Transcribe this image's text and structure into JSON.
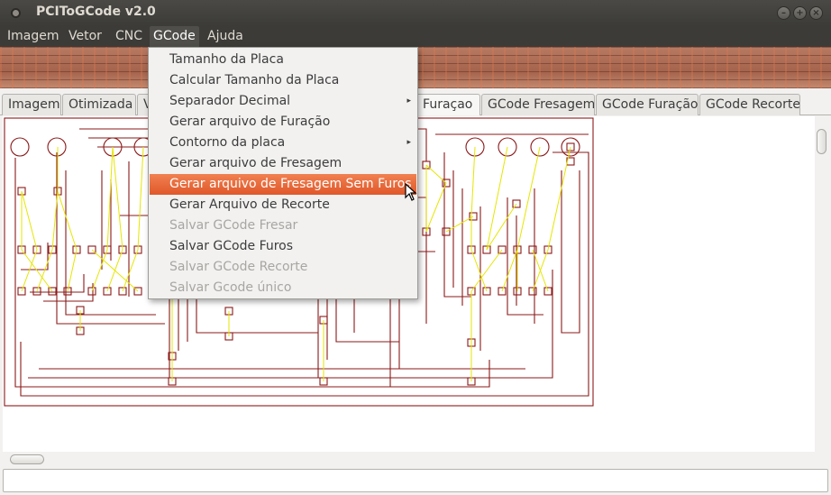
{
  "window": {
    "title": "PCIToGCode  v2.0",
    "controls": {
      "minimize": "–",
      "maximize": "+",
      "close": "×"
    }
  },
  "menubar": {
    "items": [
      "Imagem",
      "Vetor",
      "CNC",
      "GCode",
      "Ajuda"
    ],
    "active": "GCode"
  },
  "tabs": {
    "items": [
      "Imagem",
      "Otimizada",
      "V",
      "a Furaçao",
      "GCode Fresagem",
      "GCode Furação",
      "GCode Recorte"
    ],
    "selected_index": 3
  },
  "gcode_menu": {
    "items": [
      {
        "label": "Tamanho da Placa",
        "enabled": true
      },
      {
        "label": "Calcular Tamanho da Placa",
        "enabled": true
      },
      {
        "label": "Separador Decimal",
        "enabled": true,
        "submenu": true
      },
      {
        "label": "Gerar arquivo de Furação",
        "enabled": true
      },
      {
        "label": "Contorno da placa",
        "enabled": true,
        "submenu": true
      },
      {
        "label": "Gerar arquivo de Fresagem",
        "enabled": true
      },
      {
        "label": "Gerar arquivo de Fresagem Sem Furos",
        "enabled": true,
        "highlighted": true
      },
      {
        "label": "Gerar Arquivo de Recorte",
        "enabled": true
      },
      {
        "label": "Salvar GCode Fresar",
        "enabled": false
      },
      {
        "label": "Salvar GCode Furos",
        "enabled": true
      },
      {
        "label": "Salvar GCode Recorte",
        "enabled": false
      },
      {
        "label": "Salvar Gcode único",
        "enabled": false
      }
    ],
    "submenu_arrow": "▸"
  },
  "colors": {
    "trace": "#8b1a1a",
    "path": "#e6e600",
    "highlight": "#e95e2c",
    "titlebar": "#3c3b37"
  }
}
